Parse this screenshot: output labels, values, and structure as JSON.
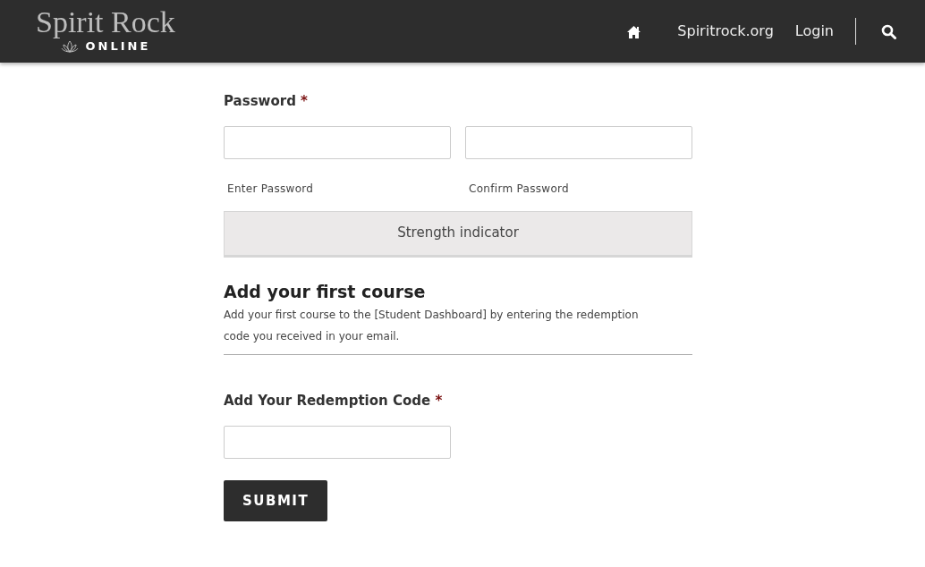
{
  "header": {
    "logo": {
      "title": "Spirit Rock",
      "subtitle": "ONLINE"
    },
    "nav": [
      {
        "kind": "home"
      },
      {
        "kind": "link",
        "label": "Spiritrock.org"
      },
      {
        "kind": "link",
        "label": "Login"
      },
      {
        "kind": "search"
      }
    ]
  },
  "password": {
    "label": "Password",
    "required_mark": "*",
    "fields": [
      {
        "caption": "Enter Password"
      },
      {
        "caption": "Confirm Password"
      }
    ],
    "strength": "Strength indicator"
  },
  "course": {
    "heading": "Add your first course",
    "description": "Add your first course to the [Student Dashboard] by entering the redemption code you received in your email."
  },
  "redemption": {
    "label": "Add Your Redemption Code",
    "required_mark": "*"
  },
  "submit": "SUBMIT"
}
